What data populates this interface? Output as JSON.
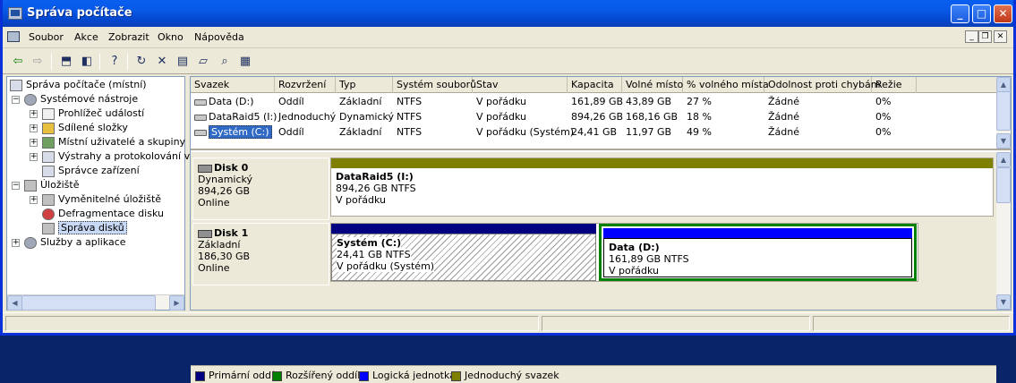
{
  "window": {
    "title": "Správa počítače"
  },
  "menu": [
    "Soubor",
    "Akce",
    "Zobrazit",
    "Okno",
    "Nápověda"
  ],
  "tree": {
    "root": "Správa počítače (místní)",
    "system_tools": "Systémové nástroje",
    "event_viewer": "Prohlížeč událostí",
    "shared_folders": "Sdílené složky",
    "local_users": "Místní uživatelé a skupiny",
    "alerts": "Výstrahy a protokolování výk",
    "device_manager": "Správce zařízení",
    "storage": "Úložiště",
    "removable": "Vyměnitelné úložiště",
    "defrag": "Defragmentace disku",
    "disk_mgmt": "Správa disků",
    "services": "Služby a aplikace"
  },
  "volumes": {
    "columns": [
      "Svazek",
      "Rozvržení",
      "Typ",
      "Systém souborů",
      "Stav",
      "Kapacita",
      "Volné místo",
      "% volného místa",
      "Odolnost proti chybám",
      "Režie"
    ],
    "rows": [
      [
        "Data (D:)",
        "Oddíl",
        "Základní",
        "NTFS",
        "V pořádku",
        "161,89 GB",
        "43,89 GB",
        "27 %",
        "Žádné",
        "0%"
      ],
      [
        "DataRaid5 (I:)",
        "Jednoduchý",
        "Dynamický",
        "NTFS",
        "V pořádku",
        "894,26 GB",
        "168,16 GB",
        "18 %",
        "Žádné",
        "0%"
      ],
      [
        "Systém (C:)",
        "Oddíl",
        "Základní",
        "NTFS",
        "V pořádku (Systém)",
        "24,41 GB",
        "11,97 GB",
        "49 %",
        "Žádné",
        "0%"
      ]
    ]
  },
  "disks": {
    "disk0": {
      "name": "Disk 0",
      "type": "Dynamický",
      "size": "894,26 GB",
      "status": "Online",
      "partition": {
        "name": "DataRaid5  (I:)",
        "info": "894,26 GB NTFS",
        "status": "V pořádku"
      }
    },
    "disk1": {
      "name": "Disk 1",
      "type": "Základní",
      "size": "186,30 GB",
      "status": "Online",
      "p1": {
        "name": "Systém  (C:)",
        "info": "24,41 GB NTFS",
        "status": "V pořádku (Systém)"
      },
      "p2": {
        "name": "Data  (D:)",
        "info": "161,89 GB NTFS",
        "status": "V pořádku"
      }
    }
  },
  "legend": [
    "Primární oddíl",
    "Rozšířený oddíl",
    "Logická jednotka",
    "Jednoduchý svazek"
  ],
  "colors": {
    "primary": "#000080",
    "extended": "#008000",
    "logical": "#0000ff",
    "simple": "#808000"
  }
}
